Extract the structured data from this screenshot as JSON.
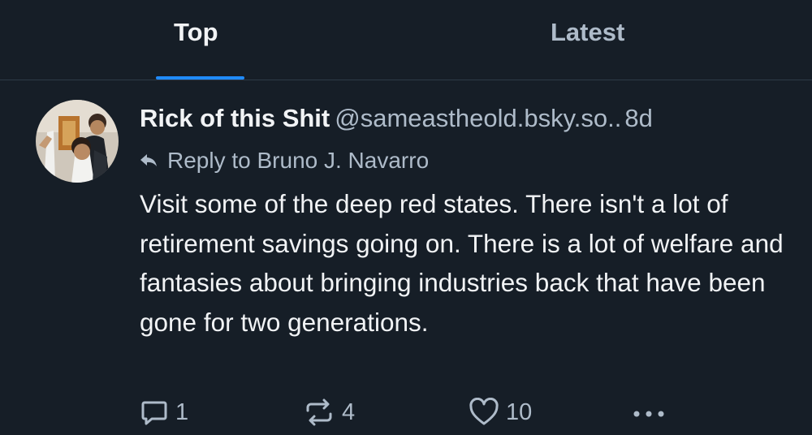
{
  "tabs": [
    {
      "label": "Top",
      "active": true
    },
    {
      "label": "Latest",
      "active": false
    }
  ],
  "post": {
    "author_name": "Rick of this Shit",
    "author_handle": "@sameastheold.bsky.so..",
    "time": "8d",
    "reply_to": "Reply to Bruno J. Navarro",
    "text": "Visit some of the deep red states. There isn't a lot of retirement savings going on. There is a lot of welfare and fantasies about bringing industries back that have been gone for two generations.",
    "reply_count": "1",
    "repost_count": "4",
    "like_count": "10"
  },
  "icons": {
    "reply": "speech-bubble-icon",
    "repost": "repost-arrows-icon",
    "like": "heart-icon",
    "more": "ellipsis-icon",
    "reply_to": "reply-arrow-icon"
  },
  "colors": {
    "background": "#161e27",
    "accent": "#208bfe",
    "text": "#f1f3f5",
    "muted": "#aebbc9",
    "divider": "#2e3a47"
  }
}
